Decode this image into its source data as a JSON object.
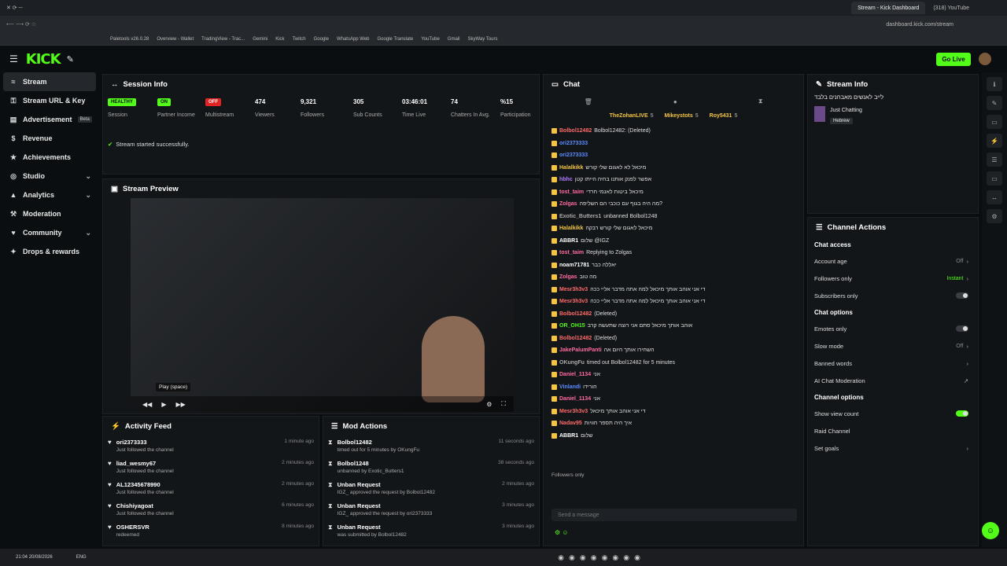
{
  "browser": {
    "tabs": [
      {
        "label": "Stream - Kick Dashboard",
        "active": true
      },
      {
        "label": "(318) YouTube",
        "active": false
      }
    ],
    "url": "dashboard.kick.com/stream",
    "bookmarks": [
      "Paletools v26.0.28",
      "Overview - Wallet",
      "TradingView - Trac...",
      "Gemini",
      "Kick",
      "Twitch",
      "Google",
      "WhatsApp Web",
      "Google Translate",
      "YouTube",
      "Gmail",
      "SkyWay Tours"
    ]
  },
  "header": {
    "logo": "KICK",
    "go_live": "Go Live"
  },
  "sidebar": {
    "items": [
      {
        "label": "Stream",
        "icon": "≈",
        "active": true,
        "chevron": false
      },
      {
        "label": "Stream URL & Key",
        "icon": "⚿",
        "active": false,
        "chevron": false
      },
      {
        "label": "Advertisement",
        "icon": "▤",
        "active": false,
        "badge": "Beta",
        "chevron": false
      },
      {
        "label": "Revenue",
        "icon": "$",
        "active": false,
        "chevron": false
      },
      {
        "label": "Achievements",
        "icon": "★",
        "active": false,
        "chevron": false
      },
      {
        "label": "Studio",
        "icon": "◎",
        "active": false,
        "chevron": true
      },
      {
        "label": "Analytics",
        "icon": "▲",
        "active": false,
        "chevron": true
      },
      {
        "label": "Moderation",
        "icon": "⚒",
        "active": false,
        "chevron": false
      },
      {
        "label": "Community",
        "icon": "♥",
        "active": false,
        "chevron": true
      },
      {
        "label": "Drops & rewards",
        "icon": "✦",
        "active": false,
        "chevron": false
      }
    ]
  },
  "session": {
    "title": "Session Info",
    "stats": [
      {
        "pill": "HEALTHY",
        "label": "Session",
        "color": "#53fc18"
      },
      {
        "pill": "ON",
        "label": "Partner Income",
        "color": "#53fc18"
      },
      {
        "pill": "OFF",
        "label": "Multistream",
        "color": "#e02424"
      },
      {
        "value": "474",
        "label": "Viewers"
      },
      {
        "value": "9,321",
        "label": "Followers"
      },
      {
        "value": "305",
        "label": "Sub Counts"
      },
      {
        "value": "03:46:01",
        "label": "Time Live"
      },
      {
        "value": "74",
        "label": "Chatters In Avg."
      },
      {
        "value": "%15",
        "label": "Participation"
      }
    ],
    "status": "Stream started successfully."
  },
  "preview": {
    "title": "Stream Preview",
    "tooltip": "Play (space)"
  },
  "activity": {
    "title": "Activity Feed",
    "items": [
      {
        "name": "ori2373333",
        "sub": "Just followed the channel",
        "time": "1 minute ago"
      },
      {
        "name": "liad_wesmy67",
        "sub": "Just followed the channel",
        "time": "2 minutes ago"
      },
      {
        "name": "AL12345678990",
        "sub": "Just followed the channel",
        "time": "2 minutes ago"
      },
      {
        "name": "Chishiyagoat",
        "sub": "Just followed the channel",
        "time": "6 minutes ago"
      },
      {
        "name": "OSHERSVR",
        "sub": "redeemed",
        "time": "8 minutes ago"
      }
    ]
  },
  "mod": {
    "title": "Mod Actions",
    "items": [
      {
        "name": "Bolbol12482",
        "sub": "timed out for 5 minutes by OKungFu",
        "time": "11 seconds ago"
      },
      {
        "name": "Bolbol1248",
        "sub": "unbanned by Exotic_Butters1",
        "time": "38 seconds ago"
      },
      {
        "name": "Unban Request",
        "sub": "IGZ_ approved the request by Bolbol12482",
        "time": "2 minutes ago"
      },
      {
        "name": "Unban Request",
        "sub": "IGZ_ approved the request by ori2373333",
        "time": "3 minutes ago"
      },
      {
        "name": "Unban Request",
        "sub": "was submitted by Bolbol12482",
        "time": "3 minutes ago"
      }
    ]
  },
  "chat": {
    "title": "Chat",
    "top_gifters": [
      {
        "name": "TheZohanLIVE",
        "n": "5"
      },
      {
        "name": "Mikeystots",
        "n": "5"
      },
      {
        "name": "Roy5431",
        "n": "5"
      }
    ],
    "lines": [
      {
        "user": "Bolbol12482",
        "color": "#ff6a6a",
        "text": "Bolbol12482: (Deleted)"
      },
      {
        "user": "ori2373333",
        "color": "#5b8cff",
        "text": ""
      },
      {
        "user": "ori2373333",
        "color": "#5b8cff",
        "text": ""
      },
      {
        "user": "Halalkikk",
        "color": "#f5c542",
        "text": "מיכאל לא לאגום שלי קורש"
      },
      {
        "user": "hbhc",
        "color": "#b07bff",
        "text": "אפשר לפנק אותנו בחיה הייתו קטן"
      },
      {
        "user": "tost_taim",
        "color": "#ff6aa0",
        "text": "מיכאל ביטות לאנמי חרדי"
      },
      {
        "user": "Zolgas",
        "color": "#ff6aa0",
        "text": "מה היה בגוף עם כוכבי הם השליפה?"
      },
      {
        "user": "Exotic_Butters1",
        "color": "#aaaaaa",
        "text": "unbanned Bolbol1248"
      },
      {
        "user": "Halalkikk",
        "color": "#f5c542",
        "text": "מיכאל לאגום שלי קורש רבקה"
      },
      {
        "user": "ABBR1",
        "color": "#ffffff",
        "text": "שלום @IGZ"
      },
      {
        "user": "tost_taim",
        "color": "#ff6aa0",
        "text": "Replying to Zolgas"
      },
      {
        "user": "noam71781",
        "color": "#ffffff",
        "text": "יאללה כבר"
      },
      {
        "user": "Zolgas",
        "color": "#ff6aa0",
        "text": "מה טוב"
      },
      {
        "user": "Mesr3h3v3",
        "color": "#ff6a6a",
        "text": "די אני אוהב אותך מיכאל למה אתה מדבר אליי ככה"
      },
      {
        "user": "Mesr3h3v3",
        "color": "#ff6a6a",
        "text": "די אני אוהב אותך מיכאל למה אתה מדבר אליי ככה"
      },
      {
        "user": "Bolbol12482",
        "color": "#ff6a6a",
        "text": "(Deleted)"
      },
      {
        "user": "OR_OH15",
        "color": "#53fc18",
        "text": "אוהב אותך מיכאל סתם אני רוצה שתעשה קרב"
      },
      {
        "user": "Bolbol12482",
        "color": "#ff6a6a",
        "text": "(Deleted)"
      },
      {
        "user": "JakePalumPanti",
        "color": "#ff6aa0",
        "text": "השחירו אותך היום אה"
      },
      {
        "user": "OKungFu",
        "color": "#aaaaaa",
        "text": "timed out Bolbol12482 for 5 minutes"
      },
      {
        "user": "Daniel_1134",
        "color": "#ff6aa0",
        "text": "אני"
      },
      {
        "user": "Vinlandi",
        "color": "#5b8cff",
        "text": "הורידו"
      },
      {
        "user": "Daniel_1134",
        "color": "#ff6aa0",
        "text": "אני"
      },
      {
        "user": "Mesr3h3v3",
        "color": "#ff6a6a",
        "text": "די אני אוהב אותך מיכאל"
      },
      {
        "user": "Nadav95",
        "color": "#ff6a6a",
        "text": "איך היה תספר חוויות"
      },
      {
        "user": "ABBR1",
        "color": "#ffffff",
        "text": "שלום"
      }
    ],
    "followers_only": "Followers only",
    "placeholder": "Send a message"
  },
  "streaminfo": {
    "title": "Stream Info",
    "stream_title": "לייב לאנשים מאבחנים בלבד",
    "category": "Just Chatting",
    "tag": "Hebrew"
  },
  "actions": {
    "title": "Channel Actions",
    "sections": [
      {
        "heading": "Chat access",
        "rows": [
          {
            "label": "Account age",
            "value": "Off",
            "kind": "chevron"
          },
          {
            "label": "Followers only",
            "value": "Instant",
            "kind": "chevron",
            "accent": true
          },
          {
            "label": "Subscribers only",
            "value": "",
            "kind": "toggle",
            "on": false
          }
        ]
      },
      {
        "heading": "Chat options",
        "rows": [
          {
            "label": "Emotes only",
            "value": "",
            "kind": "toggle",
            "on": false
          },
          {
            "label": "Slow mode",
            "value": "Off",
            "kind": "chevron"
          },
          {
            "label": "Banned words",
            "value": "",
            "kind": "chevron"
          },
          {
            "label": "AI Chat Moderation",
            "value": "",
            "kind": "link"
          }
        ]
      },
      {
        "heading": "Channel options",
        "rows": [
          {
            "label": "Show view count",
            "value": "",
            "kind": "toggle",
            "on": true
          },
          {
            "label": "Raid Channel",
            "value": "",
            "kind": "none"
          },
          {
            "label": "Set goals",
            "value": "",
            "kind": "chevron"
          }
        ]
      }
    ]
  },
  "taskbar": {
    "time": "21:04",
    "date": "20/08/2026",
    "lang": "ENG"
  }
}
